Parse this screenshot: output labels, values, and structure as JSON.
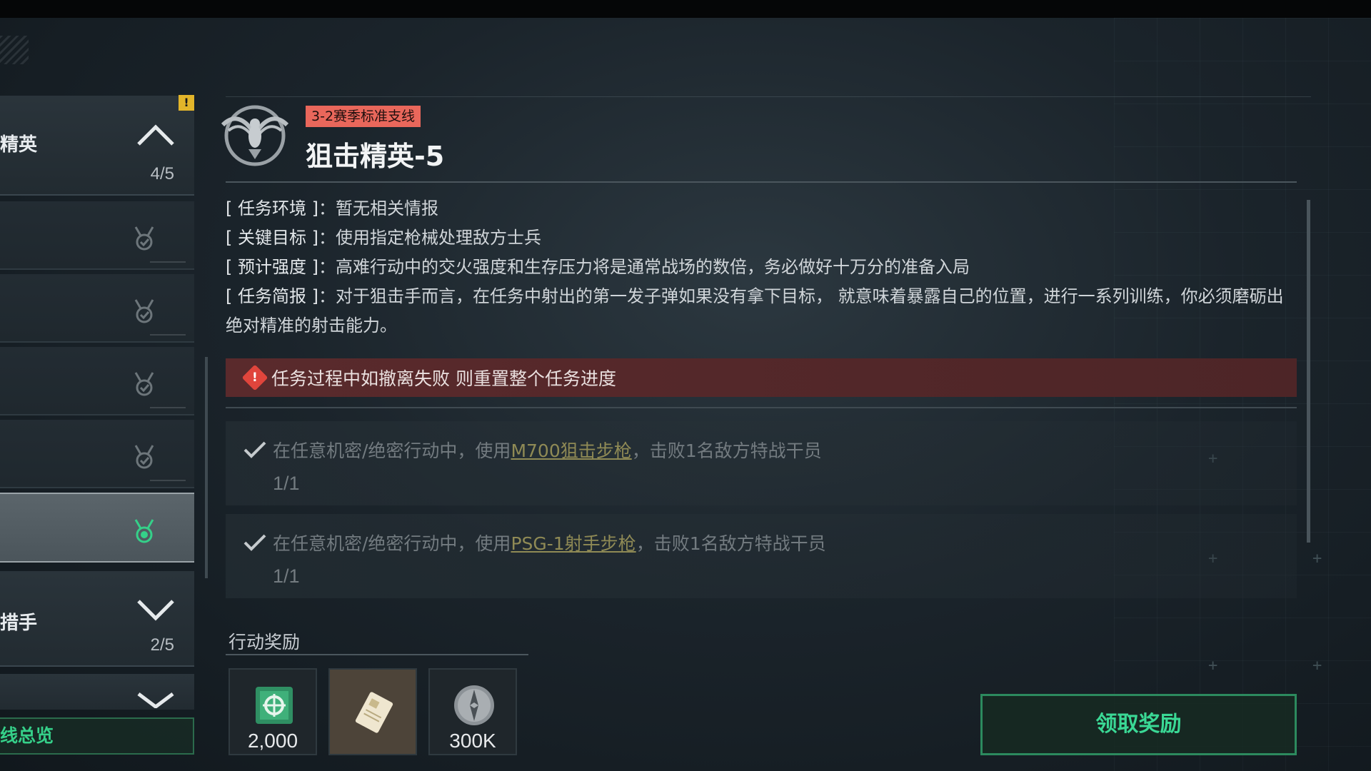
{
  "sidebar": {
    "group_top": {
      "name": "精英",
      "count": "4/5",
      "badge": "!"
    },
    "group_bottom": {
      "name": "措手",
      "count": "2/5"
    },
    "overview_label": "线总览"
  },
  "mission": {
    "season_tag": "3-2赛季标准支线",
    "title": "狙击精英-5",
    "info": [
      {
        "label": "[ 任务环境 ]",
        "value": "暂无相关情报"
      },
      {
        "label": "[ 关键目标 ]",
        "value": "使用指定枪械处理敌方士兵"
      },
      {
        "label": "[ 预计强度 ]",
        "value": "高难行动中的交火强度和生存压力将是通常战场的数倍，务必做好十万分的准备入局"
      },
      {
        "label": "[ 任务简报 ]",
        "value": "对于狙击手而言，在任务中射出的第一发子弹如果没有拿下目标， 就意味着暴露自己的位置，进行一系列训练，你必须磨砺出绝对精准的射击能力。"
      }
    ],
    "separator": "：",
    "alert": "任务过程中如撤离失败 则重置整个任务进度"
  },
  "objectives": [
    {
      "prefix": "在任意机密/绝密行动中，使用",
      "weapon": "M700狙击步枪",
      "suffix": "，击败1名敌方特战干员",
      "progress": "1/1",
      "completed": true
    },
    {
      "prefix": "在任意机密/绝密行动中，使用",
      "weapon": "PSG-1射手步枪",
      "suffix": "，击败1名敌方特战干员",
      "progress": "1/1",
      "completed": true
    }
  ],
  "rewards": {
    "label": "行动奖励",
    "items": [
      {
        "icon": "supply-crate-icon",
        "quantity": "2,000"
      },
      {
        "icon": "document-card-icon",
        "quantity": ""
      },
      {
        "icon": "currency-coin-icon",
        "quantity": "300K"
      }
    ]
  },
  "claim_button": "领取奖励",
  "colors": {
    "accent_green": "#3ad895",
    "season_tag": "#e9675b",
    "alert_bg": "#5a2a2c",
    "weapon_link": "#8f8a55"
  }
}
